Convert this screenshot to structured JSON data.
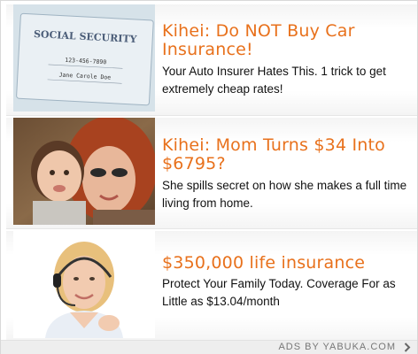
{
  "ads": [
    {
      "headline": "Kihei: Do NOT Buy Car Insurance!",
      "description": "Your Auto Insurer Hates This. 1 trick to get extremely cheap rates!",
      "image": "social-security-card-image",
      "card": {
        "header": "SOCIAL SECURITY",
        "number": "123-456-7890",
        "name": "Jane Carole Doe"
      }
    },
    {
      "headline": "Kihei: Mom Turns $34 Into $6795?",
      "description": "She spills secret on how she makes a full time living from home.",
      "image": "mother-and-child-photo"
    },
    {
      "headline": "$350,000 life insurance",
      "description": "Protect Your Family Today. Coverage For as Little as $13.04/month",
      "image": "headset-agent-photo"
    }
  ],
  "footer": {
    "label": "ADS BY YABUKA.COM",
    "icon": "chevron-right-icon"
  },
  "colors": {
    "headline": "#e8711c",
    "description": "#111111",
    "footer_text": "#777777"
  }
}
